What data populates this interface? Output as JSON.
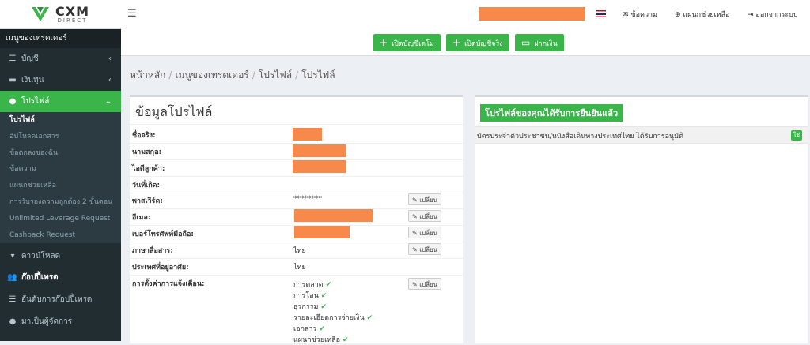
{
  "brand": {
    "name": "CXM",
    "sub": "DIRECT"
  },
  "sidebar": {
    "header": "เมนูของเทรดเดอร์",
    "items": [
      {
        "label": "บัญชี",
        "icon": "list-icon"
      },
      {
        "label": "เงินทุน",
        "icon": "wallet-icon"
      },
      {
        "label": "โปรไฟล์",
        "icon": "user-icon"
      }
    ],
    "sub_items": [
      "โปรไฟล์",
      "อัปโหลดเอกสาร",
      "ข้อตกลงของฉัน",
      "ข้อความ",
      "แผนกช่วยเหลือ",
      "การรับรองความถูกต้อง 2 ขั้นตอน",
      "Unlimited Leverage Request",
      "Cashback Request"
    ],
    "download": "ดาวน์โหลด",
    "copy_header": "ก๊อปปี้เทรด",
    "copy_items": [
      "อันดับการก๊อปปี้เทรด",
      "มาเป็นผู้จัดการ"
    ]
  },
  "topbar": {
    "messages": "ข้อความ",
    "support": "แผนกช่วยเหลือ",
    "logout": "ออกจากระบบ"
  },
  "actions": {
    "demo": "เปิดบัญชีเดโม",
    "real": "เปิดบัญชีจริง",
    "deposit": "ฝากเงิน"
  },
  "breadcrumb": [
    "หน้าหลัก",
    "เมนูของเทรดเดอร์",
    "โปรไฟล์",
    "โปรไฟล์"
  ],
  "profile": {
    "title": "ข้อมูลโปรไฟล์",
    "edit_label": "เปลี่ยน",
    "fields": [
      {
        "label": "ชื่อจริง:",
        "value": ""
      },
      {
        "label": "นามสกุล:",
        "value": ""
      },
      {
        "label": "ไอดีลูกค้า:",
        "value": ""
      },
      {
        "label": "วันที่เกิด:",
        "value": ""
      },
      {
        "label": "พาสเวิร์ด:",
        "value": "********"
      },
      {
        "label": "อีเมล:",
        "value": ""
      },
      {
        "label": "เบอร์โทรศัพท์มือถือ:",
        "value": ""
      },
      {
        "label": "ภาษาสื่อสาร:",
        "value": "ไทย"
      },
      {
        "label": "ประเทศที่อยู่อาศัย:",
        "value": "ไทย"
      },
      {
        "label": "การตั้งค่าการแจ้งเตือน:",
        "value": ""
      }
    ],
    "notifications": [
      "การตลาด",
      "การโอน",
      "ธุรกรรม",
      "รายละเอียดการจ่ายเงิน",
      "เอกสาร",
      "แผนกช่วยเหลือ"
    ]
  },
  "verify": {
    "title": "โปรไฟล์ของคุณได้รับการยืนยันแล้ว",
    "row": "บัตรประจำตัวประชาชน/หนังสือเดินทางประเทศไทย ได้รับการอนุมัติ",
    "badge": "ใช่"
  },
  "colors": {
    "accent": "#3ab54a",
    "sidebar": "#222d32",
    "redaction": "#f7894a"
  }
}
